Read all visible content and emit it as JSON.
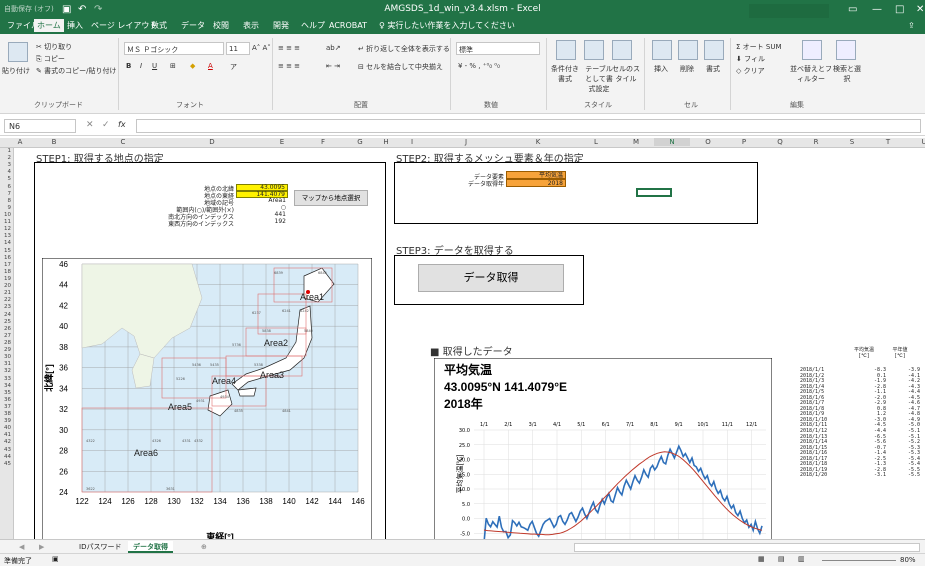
{
  "titlebar": {
    "title": "AMGSDS_1d_win_v3.4.xlsm - Excel",
    "autosave": "自動保存 (オフ)"
  },
  "menu": [
    "ファイル",
    "ホーム",
    "挿入",
    "ページ レイアウト",
    "数式",
    "データ",
    "校閲",
    "表示",
    "開発",
    "ヘルプ",
    "ACROBAT"
  ],
  "tell_me": "実行したい作業を入力してください",
  "ribbon": {
    "clipboard": {
      "paste": "貼り付け",
      "cut": "切り取り",
      "copy": "コピー",
      "format_painter": "書式のコピー/貼り付け",
      "group": "クリップボード"
    },
    "font": {
      "name": "ＭＳ Ｐゴシック",
      "size": "11",
      "group": "フォント"
    },
    "alignment": {
      "wrap": "折り返して全体を表示する",
      "merge": "セルを結合して中央揃え",
      "group": "配置"
    },
    "number": {
      "format": "標準",
      "group": "数値"
    },
    "styles": {
      "cond": "条件付き書式",
      "table": "テーブルとして書式設定",
      "cell": "セルのスタイル",
      "group": "スタイル"
    },
    "cells": {
      "insert": "挿入",
      "delete": "削除",
      "format": "書式",
      "group": "セル"
    },
    "editing": {
      "autosum": "オート SUM",
      "fill": "フィル",
      "clear": "クリア",
      "sort": "並べ替えとフィルター",
      "find": "検索と選択",
      "group": "編集"
    }
  },
  "formula": {
    "namebox": "N6",
    "fx": "fx",
    "content": ""
  },
  "columns": [
    "A",
    "B",
    "C",
    "D",
    "E",
    "F",
    "G",
    "H",
    "I",
    "J",
    "K",
    "L",
    "M",
    "N",
    "O",
    "P",
    "Q",
    "R",
    "S",
    "T",
    "U"
  ],
  "rows": [
    "1",
    "2",
    "3",
    "4",
    "5",
    "6",
    "7",
    "8",
    "9",
    "10",
    "11",
    "12",
    "13",
    "14",
    "15",
    "16",
    "17",
    "18",
    "19",
    "20",
    "21",
    "22",
    "23",
    "24",
    "25",
    "26",
    "27",
    "28",
    "29",
    "30",
    "31",
    "32",
    "33",
    "34",
    "35",
    "36",
    "37",
    "38",
    "39",
    "40",
    "41",
    "42",
    "43",
    "44",
    "45"
  ],
  "step1": {
    "heading": "STEP1: 取得する地点の指定",
    "labels": [
      "地点の北緯",
      "地点の東経",
      "地域の記号",
      "範囲内(○)/範囲外(×)",
      "南北方向のインデックス",
      "東西方向のインデックス"
    ],
    "values": [
      "43.0095",
      "141.4079",
      "Area1",
      "○",
      "441",
      "192"
    ],
    "map_button": "マップから地点選択"
  },
  "map": {
    "y_ticks": [
      "46",
      "44",
      "42",
      "40",
      "38",
      "36",
      "34",
      "32",
      "30",
      "28",
      "26",
      "24"
    ],
    "x_ticks": [
      "122",
      "124",
      "126",
      "128",
      "130",
      "132",
      "134",
      "136",
      "138",
      "140",
      "142",
      "144",
      "146"
    ],
    "xlabel": "東経[°]",
    "ylabel": "北緯[°]",
    "areas": [
      "Area1",
      "Area2",
      "Area3",
      "Area4",
      "Area5",
      "Area6"
    ],
    "cell_codes": [
      "6839",
      "6845",
      "6241",
      "6242",
      "6237",
      "5838",
      "5840",
      "5736",
      "5436",
      "5435",
      "5338",
      "5245",
      "5226",
      "4934",
      "4931",
      "4835",
      "4841",
      "4322",
      "4326",
      "4331",
      "4332",
      "3622",
      "3631"
    ]
  },
  "step2": {
    "heading": "STEP2: 取得するメッシュ要素＆年の指定",
    "labels": [
      "データ要素",
      "データ取得年"
    ],
    "values": [
      "平均気温",
      "2018"
    ]
  },
  "step3": {
    "heading": "STEP3: データを取得する",
    "button": "データ取得"
  },
  "chart_section": {
    "heading": "■ 取得したデータ"
  },
  "chart_data": {
    "type": "line",
    "title": "平均気温",
    "subtitle": "43.0095°N  141.4079°E",
    "year": "2018年",
    "ylabel": "平均気温[℃]",
    "x_top_labels": [
      "1/1",
      "2/1",
      "3/1",
      "4/1",
      "5/1",
      "6/1",
      "7/1",
      "8/1",
      "9/1",
      "10/1",
      "11/1",
      "12/1"
    ],
    "y_ticks": [
      "30.0",
      "25.0",
      "20.0",
      "15.0",
      "10.0",
      "5.0",
      "0.0",
      "-5.0"
    ],
    "ylim": [
      -10,
      30
    ],
    "series": [
      {
        "name": "平均気温",
        "color": "#2e6fba",
        "values": [
          -8.3,
          0.1,
          -1.9,
          -2.8,
          -1.1,
          -2.0,
          -2.9,
          0.8,
          -3.0,
          -4.5,
          -4.4,
          -6.5,
          -5.6,
          -0.7,
          -1.4,
          -2.5,
          -1.3,
          -2.8,
          -3.1,
          -3.5,
          -4.0,
          -2.0,
          -1.0,
          -3.0,
          -5.0,
          -6.0,
          -4.0,
          -2.0,
          -1.0,
          -0.5,
          0.0,
          -1.5,
          -3.0,
          -2.0,
          0.5,
          1.0,
          -1.0,
          -2.0,
          -0.5,
          1.5,
          2.0,
          0.5,
          -1.0,
          0.5,
          2.5,
          3.5,
          1.5,
          0.0,
          2.0,
          4.0,
          5.5,
          3.0,
          2.0,
          4.5,
          6.5,
          5.0,
          7.0,
          8.5,
          6.0,
          5.5,
          8.0,
          10.5,
          9.0,
          8.0,
          11.0,
          13.0,
          11.5,
          10.0,
          12.5,
          14.5,
          13.0,
          12.0,
          14.0,
          16.5,
          15.0,
          14.0,
          17.0,
          18.0,
          16.5,
          17.5,
          19.5,
          21.0,
          19.0,
          18.5,
          21.5,
          23.5,
          22.0,
          20.5,
          22.5,
          24.5,
          23.0,
          21.0,
          22.0,
          20.5,
          19.0,
          20.5,
          18.0,
          17.5,
          16.0,
          17.0,
          15.0,
          13.5,
          14.5,
          12.0,
          11.0,
          12.5,
          10.0,
          8.5,
          9.5,
          7.0,
          6.0,
          7.5,
          5.0,
          3.5,
          4.5,
          2.0,
          1.0,
          2.5,
          0.0,
          -1.5,
          -0.5,
          -3.0,
          -2.0,
          -4.0,
          -1.0,
          -3.5,
          -5.0,
          -2.5
        ]
      },
      {
        "name": "平年値",
        "color": "#c0392b",
        "values": [
          -3.9,
          -4.1,
          -4.2,
          -4.3,
          -4.4,
          -4.5,
          -4.6,
          -4.7,
          -4.8,
          -4.9,
          -5.0,
          -5.1,
          -5.2,
          -5.3,
          -5.3,
          -5.4,
          -5.4,
          -5.5,
          -5.5,
          -5.4,
          -5.2,
          -5.0,
          -4.6,
          -4.1,
          -3.4,
          -2.6,
          -1.7,
          -0.7,
          0.4,
          1.6,
          2.8,
          4.0,
          5.3,
          6.6,
          7.9,
          9.2,
          10.5,
          11.8,
          13.0,
          14.2,
          15.3,
          16.4,
          17.4,
          18.4,
          19.3,
          20.2,
          21.0,
          21.6,
          22.1,
          22.4,
          22.6,
          22.5,
          22.2,
          21.7,
          21.0,
          20.1,
          19.0,
          17.8,
          16.5,
          15.1,
          13.6,
          12.1,
          10.6,
          9.1,
          7.6,
          6.2,
          4.8,
          3.5,
          2.3,
          1.2,
          0.2,
          -0.7,
          -1.5,
          -2.2,
          -2.8,
          -3.3,
          -3.7,
          -4.0
        ]
      }
    ]
  },
  "table": {
    "headers": [
      [
        "平均気温",
        "平年値"
      ],
      [
        "[℃]",
        "[℃]"
      ]
    ],
    "rows": [
      [
        "2018/1/1",
        "-8.3",
        "-3.9"
      ],
      [
        "2018/1/2",
        "0.1",
        "-4.1"
      ],
      [
        "2018/1/3",
        "-1.9",
        "-4.2"
      ],
      [
        "2018/1/4",
        "-2.8",
        "-4.3"
      ],
      [
        "2018/1/5",
        "-1.1",
        "-4.4"
      ],
      [
        "2018/1/6",
        "-2.0",
        "-4.5"
      ],
      [
        "2018/1/7",
        "-2.9",
        "-4.6"
      ],
      [
        "2018/1/8",
        "0.8",
        "-4.7"
      ],
      [
        "2018/1/9",
        "1.2",
        "-4.8"
      ],
      [
        "2018/1/10",
        "-3.0",
        "-4.9"
      ],
      [
        "2018/1/11",
        "-4.5",
        "-5.0"
      ],
      [
        "2018/1/12",
        "-4.4",
        "-5.1"
      ],
      [
        "2018/1/13",
        "-6.5",
        "-5.1"
      ],
      [
        "2018/1/14",
        "-5.6",
        "-5.2"
      ],
      [
        "2018/1/15",
        "-0.7",
        "-5.3"
      ],
      [
        "2018/1/16",
        "-1.4",
        "-5.3"
      ],
      [
        "2018/1/17",
        "-2.5",
        "-5.4"
      ],
      [
        "2018/1/18",
        "-1.3",
        "-5.4"
      ],
      [
        "2018/1/19",
        "-2.8",
        "-5.5"
      ],
      [
        "2018/1/20",
        "-3.1",
        "-5.5"
      ]
    ]
  },
  "sheet_tabs": [
    "IDパスワード",
    "データ取得"
  ],
  "status": {
    "left": "準備完了",
    "zoom": "80%"
  }
}
